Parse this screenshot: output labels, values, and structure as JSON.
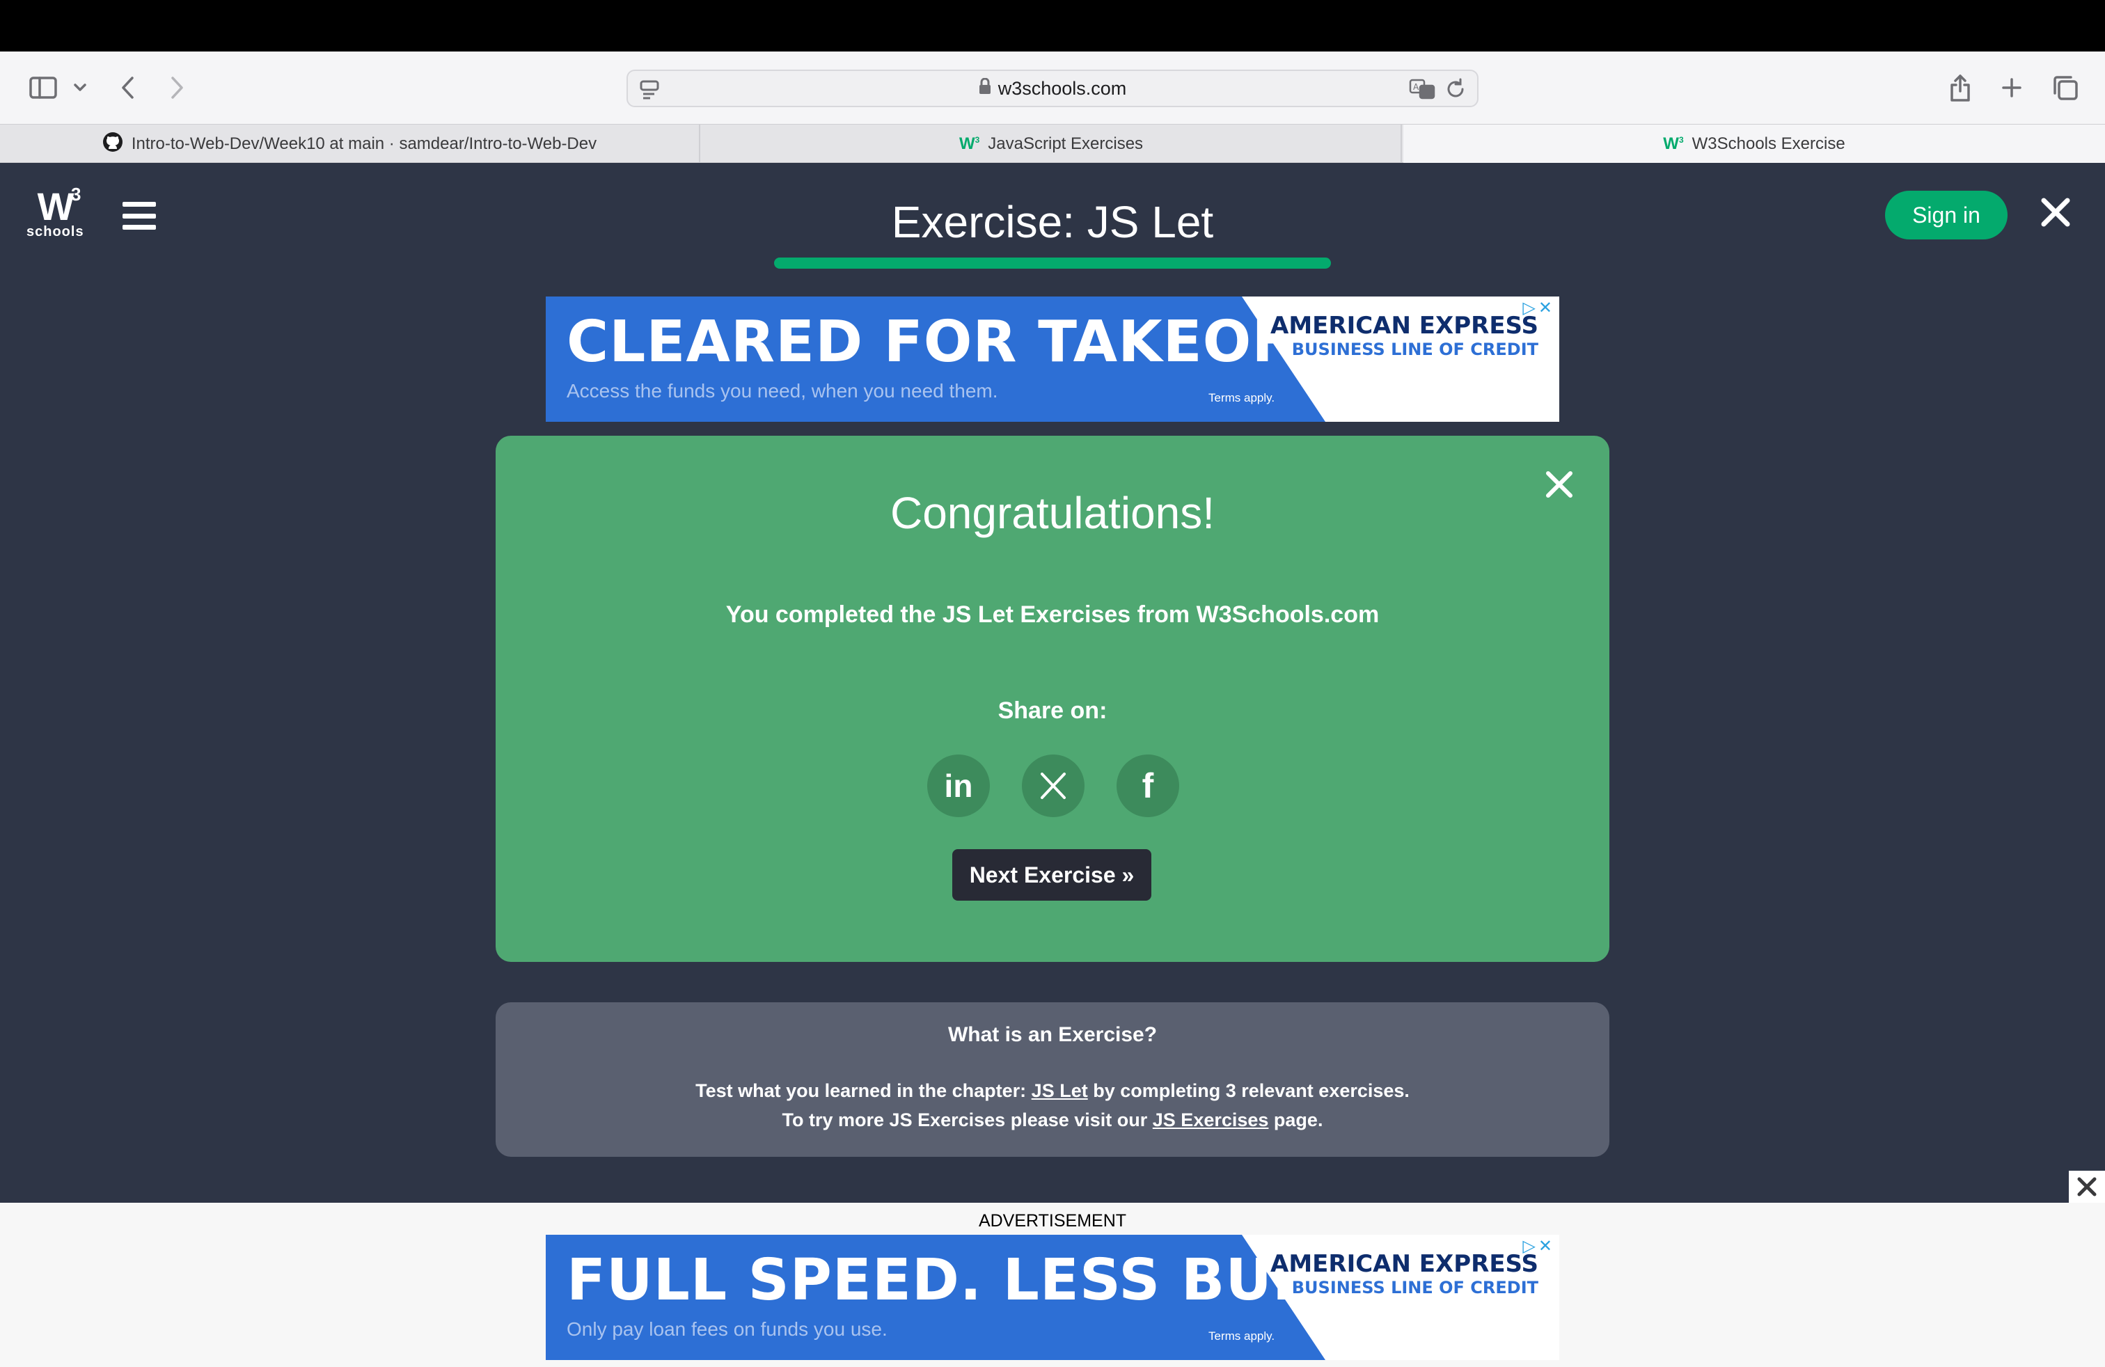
{
  "browser": {
    "url": "w3schools.com",
    "tabs": [
      {
        "label": "Intro-to-Web-Dev/Week10 at main · samdear/Intro-to-Web-Dev",
        "icon": "github-icon"
      },
      {
        "label": "JavaScript Exercises",
        "icon": "w3schools-icon"
      },
      {
        "label": "W3Schools Exercise",
        "icon": "w3schools-icon"
      }
    ],
    "tab_close": "×"
  },
  "header": {
    "logo_main": "W",
    "logo_sup": "3",
    "logo_sub": "schools",
    "title": "Exercise: JS Let",
    "progress": 1.0,
    "signin_label": "Sign in",
    "close_glyph": "✕"
  },
  "top_ad": {
    "headline": "CLEARED FOR TAKEOFF",
    "sub": "Access the funds you need, when you need them.",
    "terms": "Terms apply.",
    "brand1": "AMERICAN EXPRESS",
    "brand2": "BUSINESS LINE OF CREDIT"
  },
  "modal": {
    "title": "Congratulations!",
    "message": "You completed the JS Let Exercises from W3Schools.com",
    "share_label": "Share on:",
    "share": {
      "linkedin": "in",
      "x": "X",
      "facebook": "f"
    },
    "next_label": "Next Exercise »"
  },
  "info": {
    "title": "What is an Exercise?",
    "line1_pre": "Test what you learned in the chapter: ",
    "line1_link": "JS Let",
    "line1_post": " by completing 3 relevant exercises.",
    "line2_pre": "To try more JS Exercises please visit our ",
    "line2_link": "JS Exercises",
    "line2_post": " page."
  },
  "bottom_ad": {
    "label": "ADVERTISEMENT",
    "headline": "FULL SPEED. LESS BUMPS.",
    "sub": "Only pay loan fees on funds you use.",
    "terms": "Terms apply.",
    "brand1": "AMERICAN EXPRESS",
    "brand2": "BUSINESS LINE OF CREDIT"
  },
  "colors": {
    "page_bg": "#2e3546",
    "accent_green": "#04aa6d",
    "modal_green": "#4fa872",
    "info_gray": "#5a6070",
    "ad_blue": "#2d6fd5"
  }
}
